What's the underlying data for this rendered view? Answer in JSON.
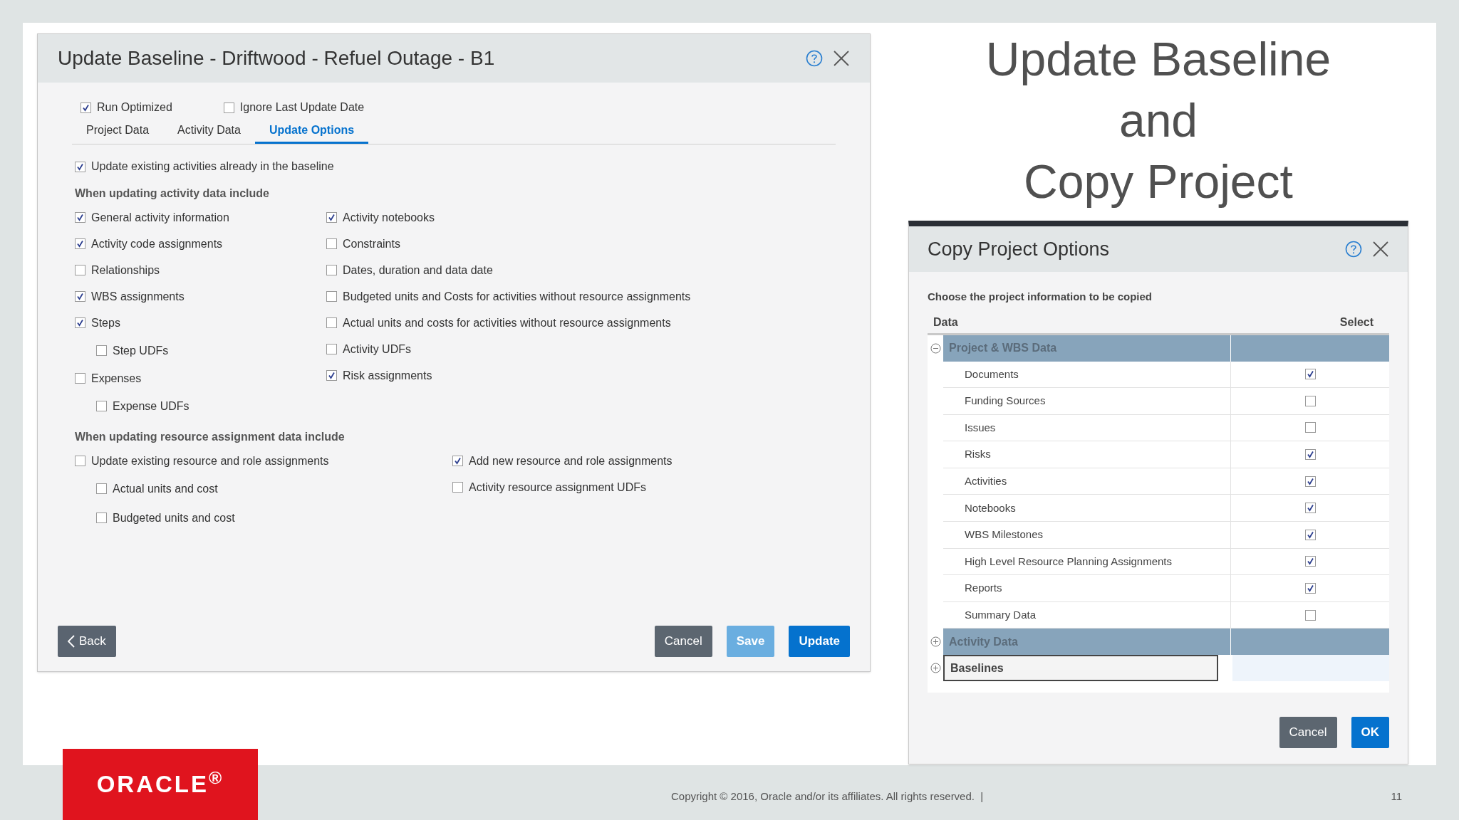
{
  "update_dialog": {
    "title": "Update Baseline - Driftwood - Refuel Outage - B1",
    "top_options": [
      {
        "label": "Run Optimized",
        "checked": true
      },
      {
        "label": "Ignore Last Update Date",
        "checked": false
      }
    ],
    "tabs": [
      {
        "label": "Project Data",
        "selected": false
      },
      {
        "label": "Activity Data",
        "selected": false
      },
      {
        "label": "Update Options",
        "selected": true
      }
    ],
    "main_option": {
      "label": "Update existing activities already in the baseline",
      "checked": true
    },
    "activity_section": {
      "heading": "When updating activity data include",
      "columns": [
        [
          {
            "label": "General activity information",
            "checked": true
          },
          {
            "label": "Activity code assignments",
            "checked": true
          },
          {
            "label": "Relationships",
            "checked": false
          },
          {
            "label": "WBS assignments",
            "checked": true
          },
          {
            "label": "Steps",
            "checked": true,
            "children": [
              {
                "label": "Step UDFs",
                "checked": false
              }
            ]
          },
          {
            "label": "Expenses",
            "checked": false,
            "children": [
              {
                "label": "Expense UDFs",
                "checked": false
              }
            ]
          }
        ],
        [
          {
            "label": "Activity notebooks",
            "checked": true
          },
          {
            "label": "Constraints",
            "checked": false
          },
          {
            "label": "Dates, duration and data date",
            "checked": false
          },
          {
            "label": "Budgeted units and Costs for activities without resource assignments",
            "checked": false
          },
          {
            "label": "Actual units and costs for activities without resource assignments",
            "checked": false
          },
          {
            "label": "Activity UDFs",
            "checked": false
          },
          {
            "label": "Risk assignments",
            "checked": true
          }
        ]
      ]
    },
    "resource_section": {
      "heading": "When updating resource assignment data include",
      "columns": [
        [
          {
            "label": "Update existing resource and role assignments",
            "checked": false,
            "children": [
              {
                "label": "Actual units and cost",
                "checked": false
              },
              {
                "label": "Budgeted units and cost",
                "checked": false
              }
            ]
          }
        ],
        [
          {
            "label": "Add new resource and role assignments",
            "checked": true
          },
          {
            "label": "Activity resource assignment UDFs",
            "checked": false
          }
        ]
      ]
    },
    "buttons": [
      {
        "label": "Back",
        "kind": "back"
      },
      {
        "label": "Cancel",
        "kind": "secondary"
      },
      {
        "label": "Save",
        "kind": "light"
      },
      {
        "label": "Update",
        "kind": "primary"
      }
    ]
  },
  "slide_heading": [
    "Update Baseline",
    "and",
    "Copy Project"
  ],
  "copy_dialog": {
    "title": "Copy Project Options",
    "instruction": "Choose the project information to be copied",
    "columns": [
      "Data",
      "Select"
    ],
    "groups": [
      {
        "label": "Project & WBS Data",
        "expanded": true,
        "focused": false,
        "rows": [
          {
            "label": "Documents",
            "checked": true
          },
          {
            "label": "Funding Sources",
            "checked": false
          },
          {
            "label": "Issues",
            "checked": false
          },
          {
            "label": "Risks",
            "checked": true
          },
          {
            "label": "Activities",
            "checked": true
          },
          {
            "label": "Notebooks",
            "checked": true
          },
          {
            "label": "WBS Milestones",
            "checked": true
          },
          {
            "label": "High Level Resource Planning Assignments",
            "checked": true
          },
          {
            "label": "Reports",
            "checked": true
          },
          {
            "label": "Summary Data",
            "checked": false
          }
        ]
      },
      {
        "label": "Activity Data",
        "expanded": false,
        "focused": false
      },
      {
        "label": "Baselines",
        "expanded": false,
        "focused": true
      }
    ],
    "buttons": [
      {
        "label": "Cancel",
        "kind": "secondary"
      },
      {
        "label": "OK",
        "kind": "primary"
      }
    ]
  },
  "footer": {
    "logo": "ORACLE$^{®}$",
    "copyright": "Copyright © 2016, Oracle and/or its affiliates. All rights reserved.  |",
    "page_number": "11"
  }
}
